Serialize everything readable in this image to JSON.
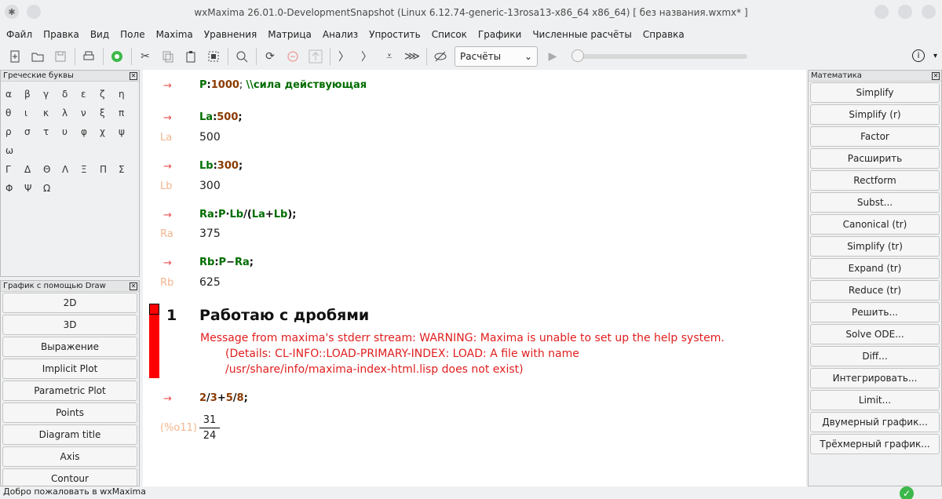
{
  "window": {
    "title": "wxMaxima 26.01.0-DevelopmentSnapshot (Linux 6.12.74-generic-13rosa13-x86_64 x86_64) [ без названия.wxmx* ]"
  },
  "menu": [
    "Файл",
    "Правка",
    "Вид",
    "Поле",
    "Maxima",
    "Уравнения",
    "Матрица",
    "Анализ",
    "Упростить",
    "Список",
    "Графики",
    "Численные расчёты",
    "Справка"
  ],
  "toolbar": {
    "mode_select": "Расчёты",
    "icons": [
      "new-file-icon",
      "open-folder-icon",
      "save-icon",
      "print-icon",
      "settings-icon",
      "cut-icon",
      "copy-icon",
      "paste-icon",
      "select-all-icon",
      "find-icon",
      "restart-icon",
      "stop-icon",
      "interrupt-icon",
      "evaluate-icon",
      "evaluate-all-icon",
      "evaluate-to-cursor-icon",
      "evaluate-all-step-icon",
      "hide-code-icon"
    ]
  },
  "greek_panel": {
    "title": "Греческие буквы",
    "letters": [
      "α",
      "β",
      "γ",
      "δ",
      "ε",
      "ζ",
      "η",
      "θ",
      "ι",
      "κ",
      "λ",
      "ν",
      "ξ",
      "π",
      "ρ",
      "σ",
      "τ",
      "υ",
      "φ",
      "χ",
      "ψ",
      "ω",
      "Γ",
      "Δ",
      "Θ",
      "Λ",
      "Ξ",
      "Π",
      "Σ",
      "Φ",
      "Ψ",
      "Ω"
    ]
  },
  "draw_panel": {
    "title": "График с помощью Draw",
    "buttons": [
      "2D",
      "3D",
      "Выражение",
      "Implicit Plot",
      "Parametric Plot",
      "Points",
      "Diagram title",
      "Axis",
      "Contour"
    ]
  },
  "math_panel": {
    "title": "Математика",
    "buttons": [
      "Simplify",
      "Simplify (r)",
      "Factor",
      "Расширить",
      "Rectform",
      "Subst...",
      "Canonical (tr)",
      "Simplify (tr)",
      "Expand (tr)",
      "Reduce (tr)",
      "Решить...",
      "Solve ODE...",
      "Diff...",
      "Интегрировать...",
      "Limit...",
      "Двумерный график...",
      "Трёхмерный график..."
    ]
  },
  "document": {
    "arrow": "→",
    "cells": [
      {
        "input_parts": [
          {
            "t": "P",
            "c": "code"
          },
          {
            "t": ":",
            "c": "op"
          },
          {
            "t": "1000",
            "c": "num"
          },
          {
            "t": "; ",
            "c": "op"
          },
          {
            "t": "\\\\сила действующая",
            "c": "code"
          }
        ]
      },
      {
        "input_parts": [
          {
            "t": "La",
            "c": "code"
          },
          {
            "t": ":",
            "c": "op"
          },
          {
            "t": "500",
            "c": "num"
          },
          {
            "t": ";",
            "c": "op"
          }
        ],
        "label": "La",
        "output": "500"
      },
      {
        "input_parts": [
          {
            "t": "Lb",
            "c": "code"
          },
          {
            "t": ":",
            "c": "op"
          },
          {
            "t": "300",
            "c": "num"
          },
          {
            "t": ";",
            "c": "op"
          }
        ],
        "label": "Lb",
        "output": "300"
      },
      {
        "input_parts": [
          {
            "t": "Ra",
            "c": "code"
          },
          {
            "t": ":",
            "c": "op"
          },
          {
            "t": "P",
            "c": "code"
          },
          {
            "t": "·",
            "c": "op"
          },
          {
            "t": "Lb",
            "c": "code"
          },
          {
            "t": "/(",
            "c": "op"
          },
          {
            "t": "La",
            "c": "code"
          },
          {
            "t": "+",
            "c": "op"
          },
          {
            "t": "Lb",
            "c": "code"
          },
          {
            "t": ");",
            "c": "op"
          }
        ],
        "label": "Ra",
        "output": "375"
      },
      {
        "input_parts": [
          {
            "t": "Rb",
            "c": "code"
          },
          {
            "t": ":",
            "c": "op"
          },
          {
            "t": "P",
            "c": "code"
          },
          {
            "t": "−",
            "c": "op"
          },
          {
            "t": "Ra",
            "c": "code"
          },
          {
            "t": ";",
            "c": "op"
          }
        ],
        "label": "Rb",
        "output": "625"
      }
    ],
    "section_number": "1",
    "section_title": "Работаю с дробями",
    "warning_lines": [
      "Message from maxima's stderr stream: WARNING: Maxima is unable to set up the help system.",
      "(Details: CL-INFO::LOAD-PRIMARY-INDEX: LOAD: A file with name",
      "/usr/share/info/maxima-index-html.lisp does not exist)"
    ],
    "fraction_input": [
      {
        "t": "2",
        "c": "num"
      },
      {
        "t": "/",
        "c": "op"
      },
      {
        "t": "3",
        "c": "num"
      },
      {
        "t": "+",
        "c": "op"
      },
      {
        "t": "5",
        "c": "num"
      },
      {
        "t": "/",
        "c": "op"
      },
      {
        "t": "8",
        "c": "num"
      },
      {
        "t": ";",
        "c": "op"
      }
    ],
    "fraction_label": "(%o11)",
    "fraction_num": "31",
    "fraction_den": "24"
  },
  "status": {
    "text": "Добро пожаловать в wxMaxima"
  },
  "colors": {
    "code": "#006d00",
    "number": "#8b3a00",
    "label": "#f2b58f",
    "warning": "#e01e1e",
    "arrow": "#e85050"
  }
}
